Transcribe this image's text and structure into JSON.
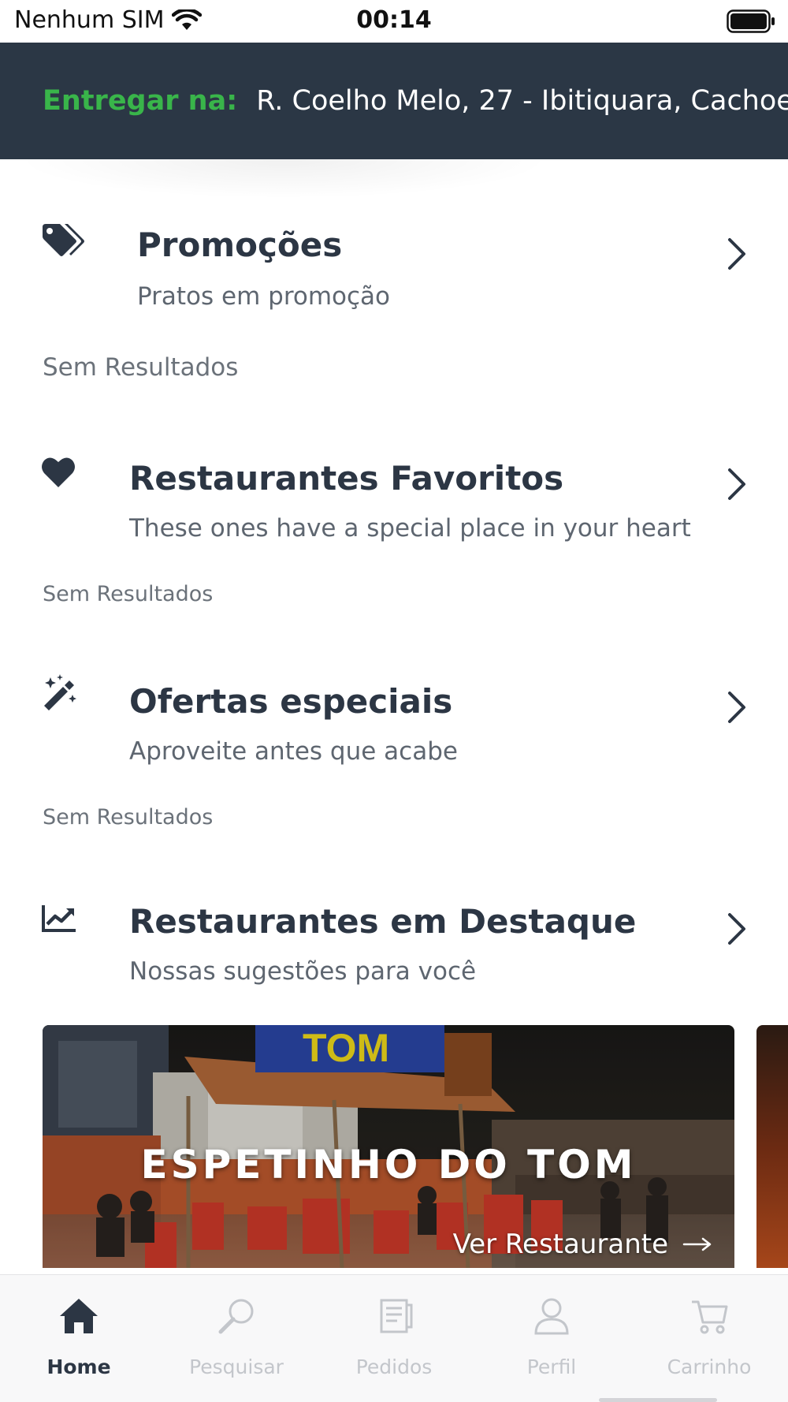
{
  "status_bar": {
    "carrier": "Nenhum SIM",
    "time": "00:14"
  },
  "address": {
    "label": "Entregar na:",
    "value": "R. Coelho Melo, 27 - Ibitiquara, Cachoe"
  },
  "sections": {
    "promocoes": {
      "icon": "tags-icon",
      "title": "Promoções",
      "subtitle": "Pratos em promoção",
      "empty": "Sem Resultados"
    },
    "favoritos": {
      "icon": "heart-icon",
      "title": "Restaurantes Favoritos",
      "subtitle": "These ones have a special place in your heart",
      "empty": "Sem Resultados"
    },
    "ofertas": {
      "icon": "magic-wand-icon",
      "title": "Ofertas especiais",
      "subtitle": "Aproveite antes que acabe",
      "empty": "Sem Resultados"
    },
    "destaque": {
      "icon": "chart-line-icon",
      "title": "Restaurantes em Destaque",
      "subtitle": "Nossas sugestões para você"
    }
  },
  "featured": [
    {
      "name": "ESPETINHO DO TOM",
      "link_label": "Ver Restaurante",
      "sign_text": "TOM"
    }
  ],
  "tabs": [
    {
      "label": "Home",
      "icon": "home-icon",
      "active": true
    },
    {
      "label": "Pesquisar",
      "icon": "search-icon",
      "active": false
    },
    {
      "label": "Pedidos",
      "icon": "receipt-icon",
      "active": false
    },
    {
      "label": "Perfil",
      "icon": "user-icon",
      "active": false
    },
    {
      "label": "Carrinho",
      "icon": "cart-icon",
      "active": false
    }
  ],
  "colors": {
    "header_bg": "#2b3745",
    "accent_green": "#39b54a",
    "text_dark": "#2c3644",
    "tab_inactive": "#c3c6cb"
  }
}
